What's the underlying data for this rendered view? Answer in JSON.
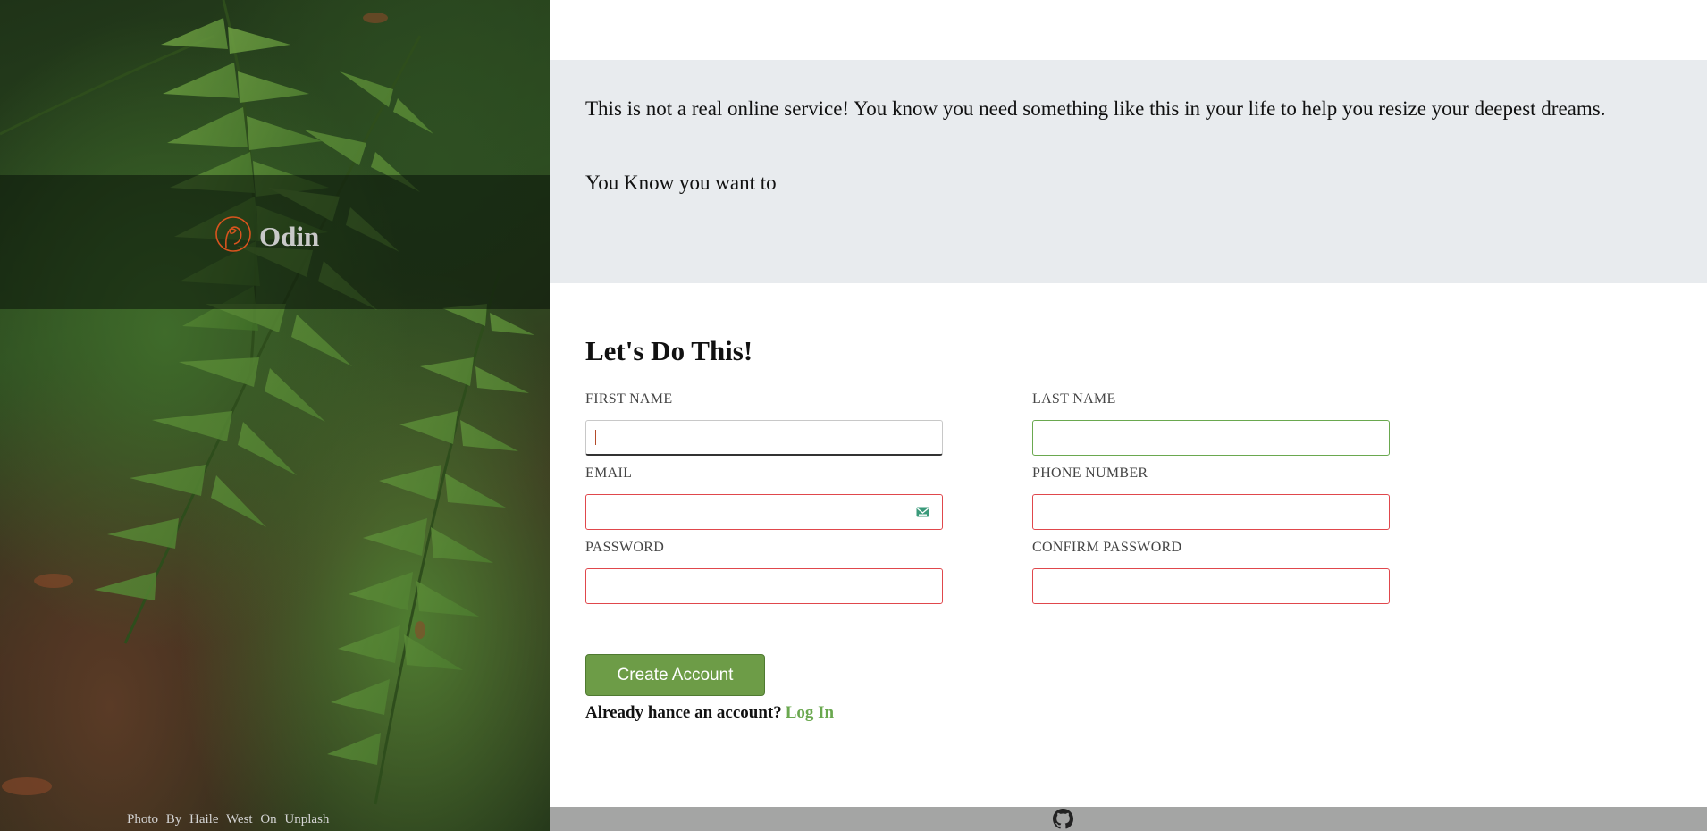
{
  "hero": {
    "logo_text": "Odin",
    "logo_icon": "odin-logo-icon",
    "photo_credit": "Photo By Haile West On Unplash"
  },
  "intro": {
    "paragraph1": "This is not a real online service! You know you need something like this in your life to help you resize your deepest dreams.",
    "paragraph2": "You Know you want to"
  },
  "form": {
    "title": "Let's Do This!",
    "fields": {
      "first_name": {
        "label": "FIRST NAME",
        "value": "",
        "state": "focused"
      },
      "last_name": {
        "label": "LAST NAME",
        "value": "",
        "state": "valid"
      },
      "email": {
        "label": "EMAIL",
        "value": "",
        "state": "invalid",
        "icon": "mail-icon"
      },
      "phone": {
        "label": "PHONE NUMBER",
        "value": "",
        "state": "invalid"
      },
      "password": {
        "label": "PASSWORD",
        "value": "",
        "state": "invalid"
      },
      "confirm_password": {
        "label": "CONFIRM PASSWORD",
        "value": "",
        "state": "invalid"
      }
    },
    "submit_label": "Create Account",
    "login_prompt": "Already hance an account?",
    "login_link": "Log In"
  },
  "footer": {
    "icon": "github-icon"
  },
  "colors": {
    "accent_green": "#6d9c47",
    "invalid_red": "#e0474c",
    "intro_bg": "#e8ebee",
    "footer_bg": "#a4a5a4",
    "logo_orange": "#d9541e"
  }
}
